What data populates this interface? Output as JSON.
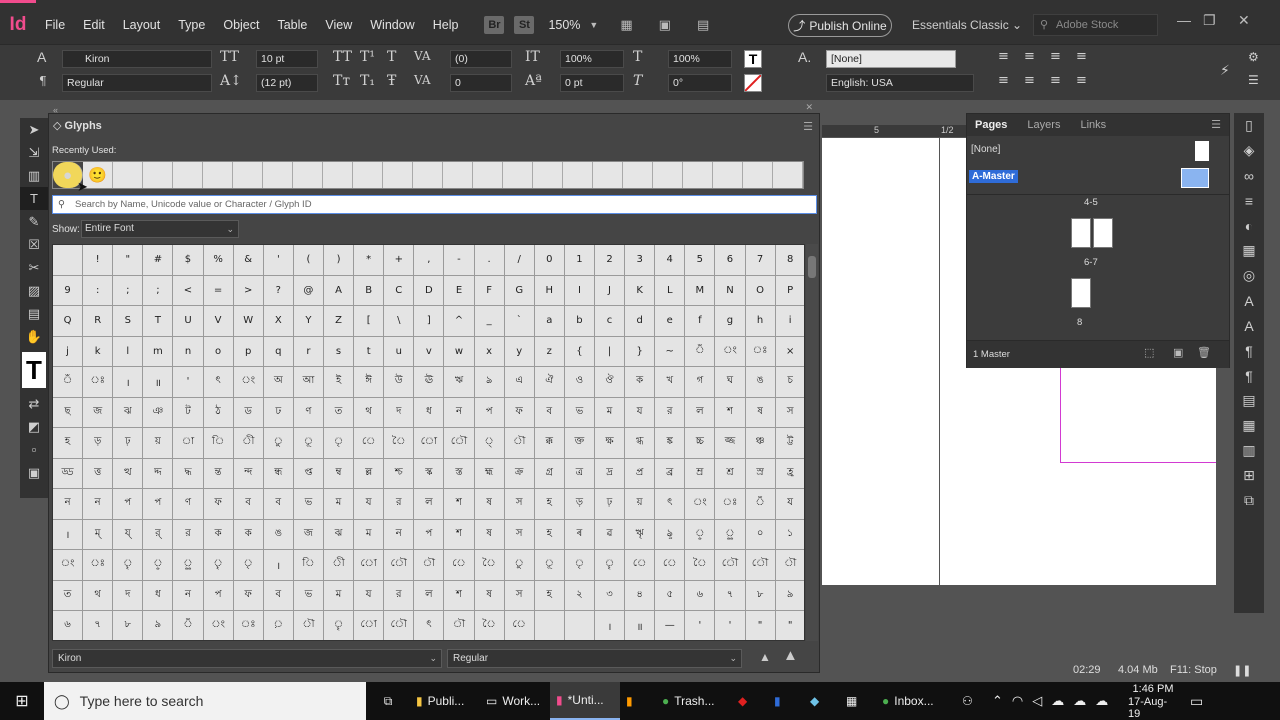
{
  "app": {
    "logo": "Id"
  },
  "menu": [
    "File",
    "Edit",
    "Layout",
    "Type",
    "Object",
    "Table",
    "View",
    "Window",
    "Help"
  ],
  "toolbar_top": {
    "br": "Br",
    "st": "St",
    "zoom": "150%",
    "publish": "Publish Online",
    "workspace": "Essentials Classic",
    "stock_placeholder": "Adobe Stock"
  },
  "control": {
    "font": "Kiron",
    "style": "Regular",
    "size": "10 pt",
    "leading": "(12 pt)",
    "kerning": "(0)",
    "tracking": "0",
    "vscale": "100%",
    "hscale": "100%",
    "baseline": "0 pt",
    "skew": "0°",
    "char_style": "[None]",
    "language": "English: USA"
  },
  "glyphs": {
    "title": "Glyphs",
    "recent_label": "Recently Used:",
    "recent": [
      "●",
      "🙂"
    ],
    "search_placeholder": "Search by Name, Unicode value or Character / Glyph ID",
    "show_label": "Show:",
    "show_value": "Entire Font",
    "font": "Kiron",
    "style": "Regular"
  },
  "glyph_rows": [
    [
      "",
      "!",
      "\"",
      "#",
      "$",
      "%",
      "&",
      "'",
      "(",
      ")",
      "*",
      "+",
      ",",
      "-",
      ".",
      "/",
      "0",
      "1",
      "2",
      "3",
      "4",
      "5",
      "6",
      "7",
      "8"
    ],
    [
      "9",
      ":",
      ";",
      ";",
      "<",
      "=",
      ">",
      "?",
      "@",
      "A",
      "B",
      "C",
      "D",
      "E",
      "F",
      "G",
      "H",
      "I",
      "J",
      "K",
      "L",
      "M",
      "N",
      "O",
      "P"
    ],
    [
      "Q",
      "R",
      "S",
      "T",
      "U",
      "V",
      "W",
      "X",
      "Y",
      "Z",
      "[",
      "\\",
      "]",
      "^",
      "_",
      "`",
      "a",
      "b",
      "c",
      "d",
      "e",
      "f",
      "g",
      "h",
      "i"
    ],
    [
      "j",
      "k",
      "l",
      "m",
      "n",
      "o",
      "p",
      "q",
      "r",
      "s",
      "t",
      "u",
      "v",
      "w",
      "x",
      "y",
      "z",
      "{",
      "|",
      "}",
      "~",
      "ঁ",
      "ং",
      "ঃ",
      "×"
    ],
    [
      "ঁ",
      "ঃ",
      "।",
      "॥",
      "'",
      "ৎ",
      "ং",
      "অ",
      "আ",
      "ই",
      "ঈ",
      "উ",
      "ঊ",
      "ঋ",
      "ঌ",
      "এ",
      "ঐ",
      "ও",
      "ঔ",
      "ক",
      "খ",
      "গ",
      "ঘ",
      "ঙ",
      "চ"
    ],
    [
      "ছ",
      "জ",
      "ঝ",
      "ঞ",
      "ট",
      "ঠ",
      "ড",
      "ঢ",
      "ণ",
      "ত",
      "থ",
      "দ",
      "ধ",
      "ন",
      "প",
      "ফ",
      "ব",
      "ভ",
      "ম",
      "য",
      "র",
      "ল",
      "শ",
      "ষ",
      "স"
    ],
    [
      "হ",
      "ড়",
      "ঢ়",
      "য়",
      "া",
      "ি",
      "ী",
      "ু",
      "ূ",
      "ৃ",
      "ে",
      "ৈ",
      "ো",
      "ৌ",
      "্",
      "ৗ",
      "ক্ক",
      "ক্ত",
      "ক্ষ",
      "গ্ধ",
      "ঙ্ক",
      "চ্চ",
      "জ্জ",
      "ঞ্চ",
      "ট্ট"
    ],
    [
      "ড্ড",
      "ত্ত",
      "ত্থ",
      "দ্দ",
      "দ্ধ",
      "ন্ত",
      "ন্দ",
      "ন্ধ",
      "প্ত",
      "ম্ব",
      "ল্ল",
      "শ্চ",
      "স্ক",
      "স্ত",
      "হ্ম",
      "ক্র",
      "গ্র",
      "ত্র",
      "দ্র",
      "প্র",
      "ব্র",
      "ম্র",
      "শ্র",
      "স্র",
      "হ্র"
    ],
    [
      "ন",
      "ন",
      "প",
      "প",
      "ণ",
      "ফ",
      "ব",
      "ব",
      "ভ",
      "ম",
      "য",
      "র",
      "ল",
      "শ",
      "ষ",
      "স",
      "হ",
      "ড়",
      "ঢ়",
      "য়",
      "ৎ",
      "ং",
      "ঃ",
      "ঁ",
      "য"
    ],
    [
      "।",
      "ম্",
      "য্",
      "র্",
      "র",
      "ক",
      "ক",
      "ঙ",
      "জ",
      "ঝ",
      "ম",
      "ন",
      "প",
      "শ",
      "ষ",
      "স",
      "হ",
      "ৰ",
      "ৱ",
      "ৠ",
      "ৡ",
      "ৢ",
      "ৣ",
      "০",
      "১"
    ],
    [
      "ং",
      "ঃ",
      "ৄ",
      "ৢ",
      "ৣ",
      "ৄ",
      "ৃ",
      "।",
      "ি",
      "ী",
      "ো",
      "ৌ",
      "ৗ",
      "ে",
      "ৈ",
      "ু",
      "ূ",
      "ৃ",
      "ৄ",
      "ে",
      "ে",
      "ৈ",
      "ৌ",
      "ৌ",
      "ৗ"
    ],
    [
      "ত",
      "থ",
      "দ",
      "ধ",
      "ন",
      "প",
      "ফ",
      "ব",
      "ভ",
      "ম",
      "য",
      "র",
      "ল",
      "শ",
      "ষ",
      "স",
      "হ",
      "২",
      "৩",
      "৪",
      "৫",
      "৬",
      "৭",
      "৮",
      "৯"
    ],
    [
      "৬",
      "৭",
      "৮",
      "৯",
      "ঁ",
      "ং",
      "ঃ",
      "়",
      "ৗ",
      "ৄ",
      "ো",
      "ৌ",
      "ৎ",
      "ৗ",
      "ৈ",
      "ে",
      "",
      "",
      "।",
      "॥",
      "—",
      "'",
      "'",
      "\"",
      "\""
    ]
  ],
  "pages": {
    "tabs": [
      "Pages",
      "Layers",
      "Links"
    ],
    "none_label": "[None]",
    "master_label": "A-Master",
    "spreads": [
      "4-5",
      "6-7",
      "8"
    ],
    "footer": "1 Master"
  },
  "ruler": {
    "mark5": "5",
    "mark_half": "1/2"
  },
  "status": {
    "time_code": "02:29",
    "size": "4.04 Mb",
    "f11": "F11: Stop"
  },
  "taskbar": {
    "search_placeholder": "Type here to search",
    "apps": [
      "Publi...",
      "Work...",
      "*Unti...",
      "Trash...",
      "Inbox..."
    ],
    "time": "1:46 PM",
    "date": "17-Aug-19"
  }
}
